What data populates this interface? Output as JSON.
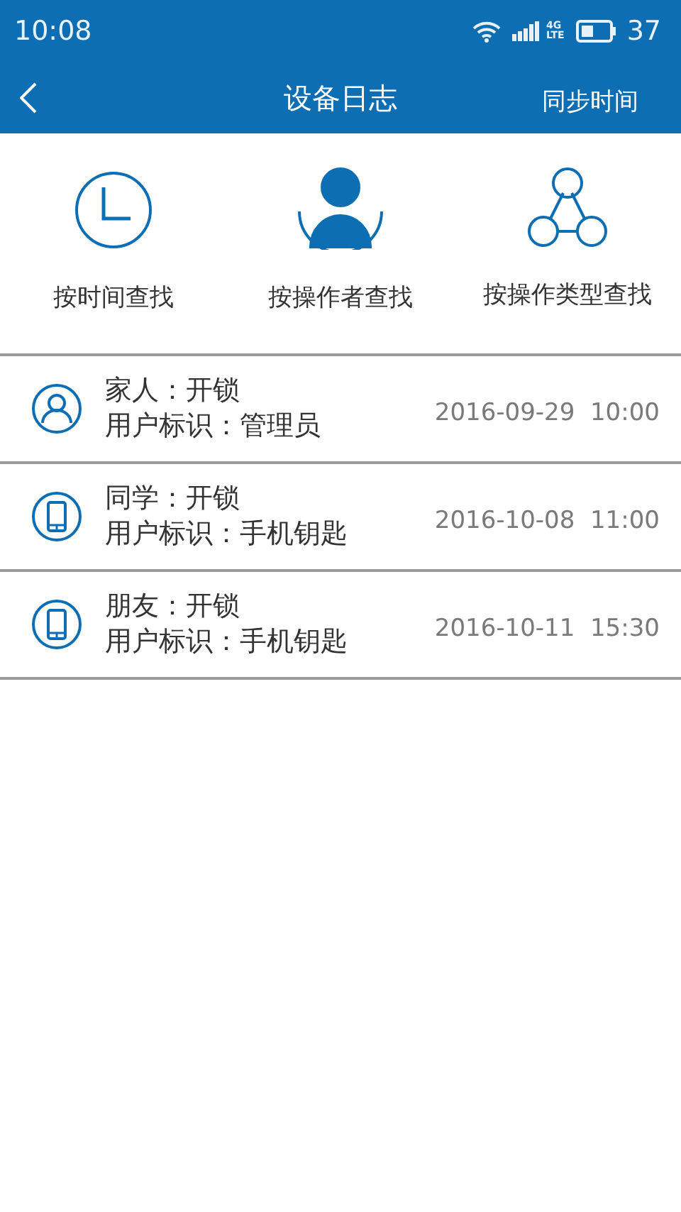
{
  "status_bar": {
    "time": "10:08",
    "network": "4G",
    "network_sub": "LTE",
    "battery": "37"
  },
  "header": {
    "title": "设备日志",
    "action": "同步时间"
  },
  "filters": [
    {
      "kind": "clock",
      "label": "按时间查找",
      "selected": false
    },
    {
      "kind": "person",
      "label": "按操作者查找",
      "selected": true
    },
    {
      "kind": "nodes",
      "label": "按操作类型查找",
      "selected": false
    }
  ],
  "logs": [
    {
      "kind": "person",
      "title": "家人：开锁",
      "detail": "用户标识：管理员",
      "time": "2016-09-29  10:00"
    },
    {
      "kind": "phone",
      "title": "同学：开锁",
      "detail": "用户标识：手机钥匙",
      "time": "2016-10-08  11:00"
    },
    {
      "kind": "phone",
      "title": "朋友：开锁",
      "detail": "用户标识：手机钥匙",
      "time": "2016-10-11  15:30"
    }
  ]
}
